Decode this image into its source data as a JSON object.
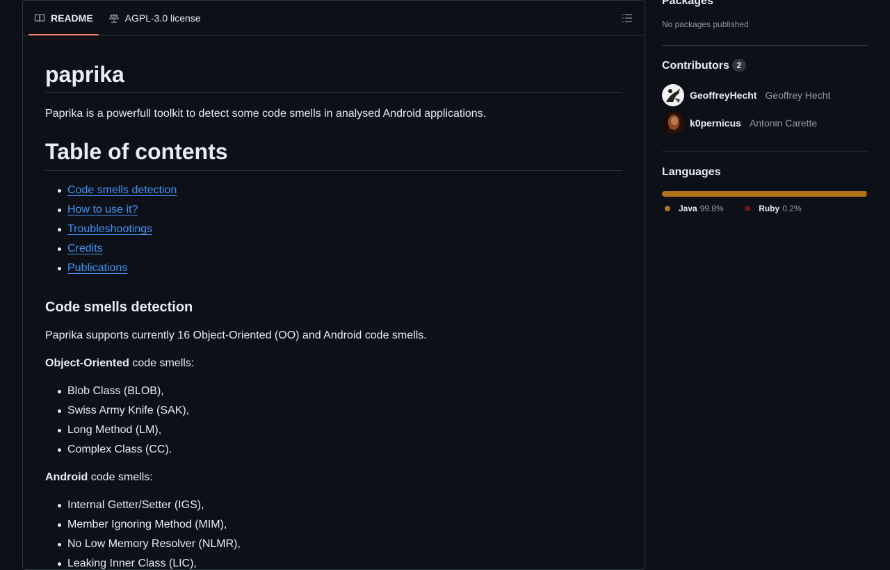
{
  "readme_tabs": {
    "readme_label": "README",
    "license_label": "AGPL-3.0 license"
  },
  "readme": {
    "title": "paprika",
    "intro": "Paprika is a powerfull toolkit to detect some code smells in analysed Android applications.",
    "toc_heading": "Table of contents",
    "toc_items": [
      "Code smells detection",
      "How to use it?",
      "Troubleshootings",
      "Credits",
      "Publications"
    ],
    "smells_heading": "Code smells detection",
    "smells_intro": "Paprika supports currently 16 Object-Oriented (OO) and Android code smells.",
    "oo_label_bold": "Object-Oriented",
    "oo_label_rest": " code smells:",
    "oo_items": [
      "Blob Class (BLOB),",
      "Swiss Army Knife (SAK),",
      "Long Method (LM),",
      "Complex Class (CC)."
    ],
    "android_label_bold": "Android",
    "android_label_rest": " code smells:",
    "android_items": [
      "Internal Getter/Setter (IGS),",
      "Member Ignoring Method (MIM),",
      "No Low Memory Resolver (NLMR),",
      "Leaking Inner Class (LIC),"
    ]
  },
  "sidebar": {
    "packages": {
      "heading": "Packages",
      "empty_text": "No packages published"
    },
    "contributors": {
      "heading": "Contributors",
      "count": "2",
      "items": [
        {
          "login": "GeoffreyHecht",
          "name": "Geoffrey Hecht",
          "avatar": "avatar-geoffrey"
        },
        {
          "login": "k0pernicus",
          "name": "Antonin Carette",
          "avatar": "avatar-k0pernicus"
        }
      ]
    },
    "languages": {
      "heading": "Languages",
      "items": [
        {
          "name": "Java",
          "percent": "99.8%",
          "value": 99.8,
          "color": "#b07219"
        },
        {
          "name": "Ruby",
          "percent": "0.2%",
          "value": 0.2,
          "color": "#701516"
        }
      ]
    }
  },
  "colors": {
    "background": "#0d1117",
    "border": "#30363d",
    "link": "#4493f8",
    "active_tab_underline": "#f78166",
    "muted_text": "#9198a1"
  }
}
